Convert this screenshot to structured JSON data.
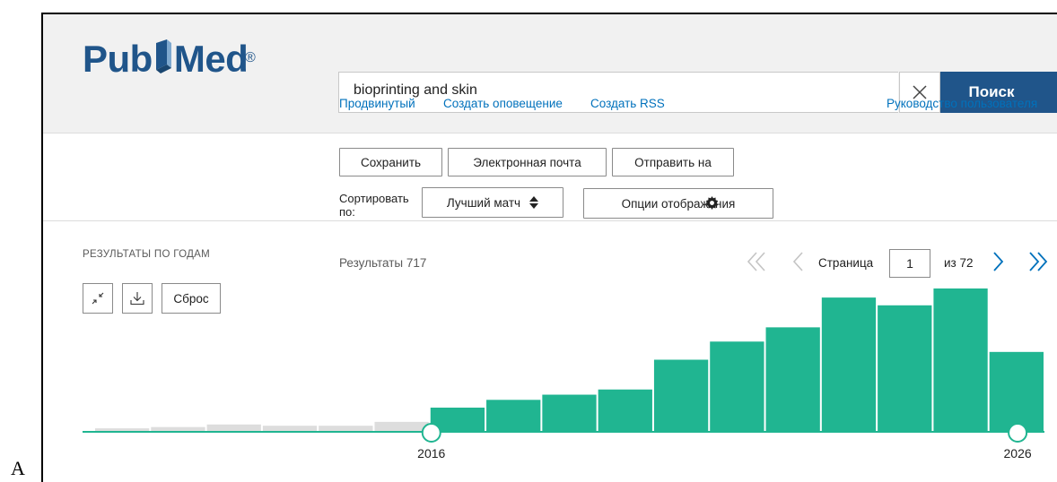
{
  "figure_label": "A",
  "header": {
    "logo_left": "Pub",
    "logo_right": "Med",
    "logo_reg": "®",
    "search_value": "bioprinting and skin",
    "search_button": "Поиск",
    "links": {
      "advanced": "Продвинутый",
      "create_alert": "Создать оповещение",
      "create_rss": "Создать RSS",
      "user_guide": "Руководство пользователя"
    }
  },
  "actions": {
    "save": "Сохранить",
    "email": "Электронная почта",
    "send_to": "Отправить на",
    "sort_label": "Сортировать по:",
    "sort_value": "Лучший матч",
    "display_options": "Опции отображения"
  },
  "results": {
    "count_text": "Результаты 717",
    "pager_label": "Страница",
    "page_value": "1",
    "page_of": "из 72"
  },
  "timeline": {
    "heading": "РЕЗУЛЬТАТЫ ПО ГОДАМ",
    "reset": "Сброс",
    "start_label": "2016",
    "end_label": "2026"
  },
  "chart_data": {
    "type": "bar",
    "title": "",
    "bar_count": 17,
    "counts": [
      2,
      3,
      5,
      4,
      4,
      7,
      18,
      24,
      28,
      32,
      55,
      69,
      80,
      103,
      97,
      110,
      61
    ],
    "selected_range_index": [
      6,
      16
    ],
    "colors": {
      "inactive": "#dddddd",
      "active_low": "#20b591",
      "active_high": "#1f7ab8",
      "axis": "#20b591"
    }
  },
  "colors": {
    "brand": "#20558a",
    "link": "#0071bc"
  }
}
